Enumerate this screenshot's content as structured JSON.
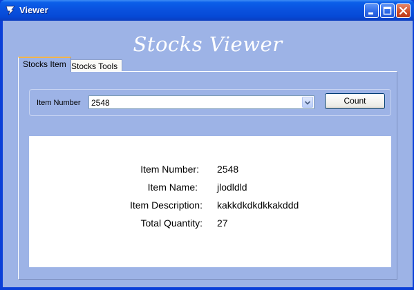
{
  "window": {
    "title": "Viewer"
  },
  "app": {
    "heading": "Stocks Viewer"
  },
  "tabs": [
    {
      "label": "Stocks Item",
      "active": true
    },
    {
      "label": "Stocks Tools",
      "active": false
    }
  ],
  "item_select": {
    "label": "Item Number",
    "value": "2548"
  },
  "count_button": {
    "label": "Count"
  },
  "details": [
    {
      "label": "Item Number:",
      "value": "2548"
    },
    {
      "label": "Item Name:",
      "value": "jlodldld"
    },
    {
      "label": "Item Description:",
      "value": "kakkdkdkdkkakddd"
    },
    {
      "label": "Total Quantity:",
      "value": "27"
    }
  ],
  "colors": {
    "titlebar": "#0a52df",
    "client_background": "#9db3e6",
    "detail_background": "#ffffff",
    "active_tab_accent": "#f3b54a"
  },
  "icons": {
    "app": "app-logo-icon",
    "minimize": "minimize-icon",
    "maximize": "maximize-icon",
    "close": "close-icon",
    "dropdown": "chevron-down-icon"
  }
}
